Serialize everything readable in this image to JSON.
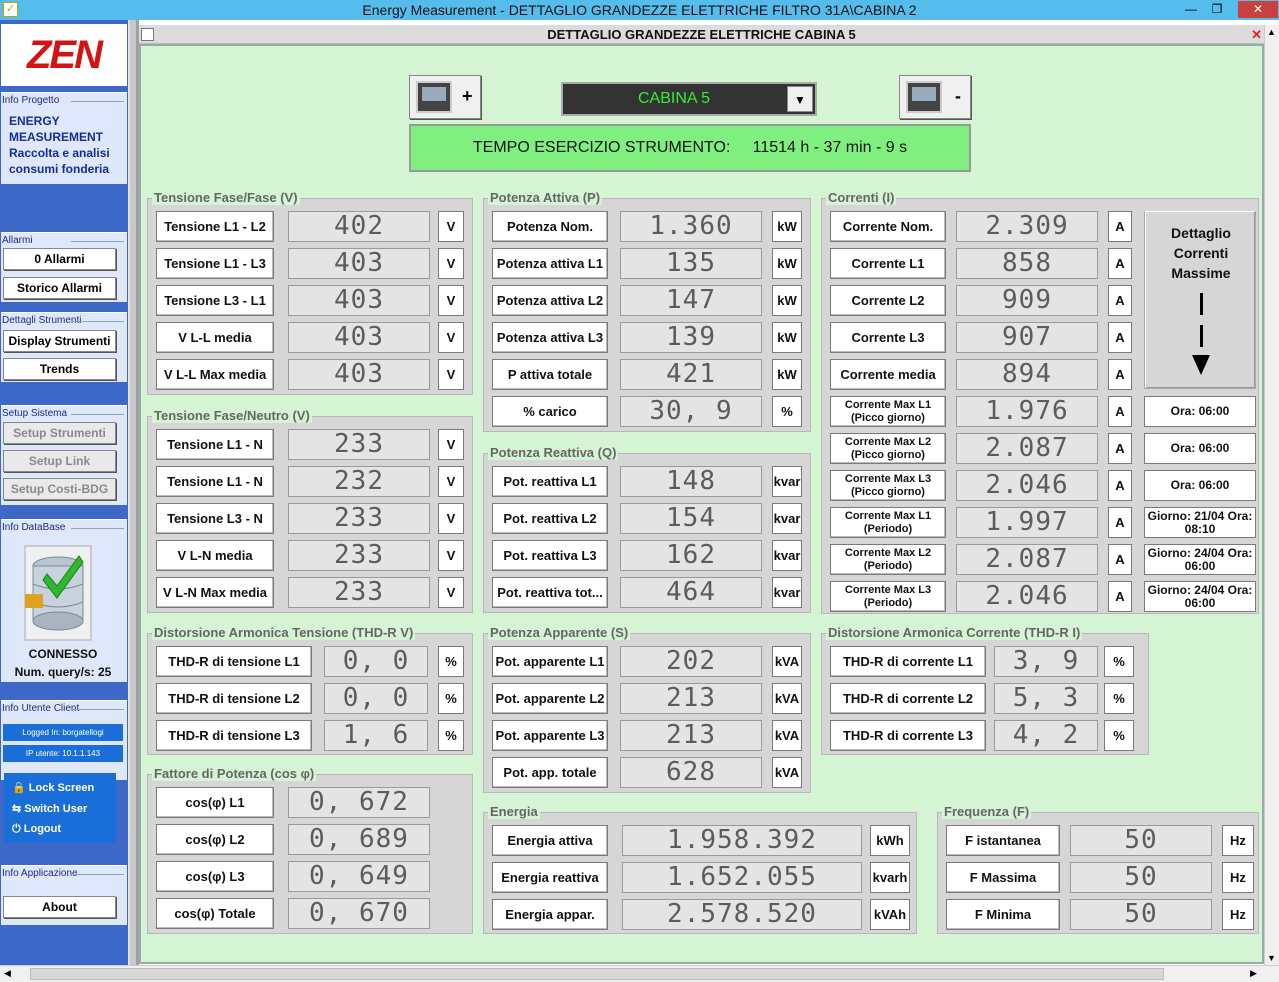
{
  "window": {
    "title": "Energy Measurement - DETTAGLIO GRANDEZZE ELETTRICHE FILTRO 31A\\CABINA 2",
    "app_icon": "check-icon",
    "btn_min": "—",
    "btn_max": "❐",
    "btn_close": "✕"
  },
  "sidebar": {
    "logo": "ZEN",
    "info_progetto": {
      "title": "Info Progetto",
      "text": [
        "ENERGY",
        "MEASUREMENT",
        "Raccolta e analisi",
        "consumi fonderia"
      ]
    },
    "allarmi": {
      "title": "Allarmi",
      "btn1": "0 Allarmi",
      "btn2": "Storico Allarmi"
    },
    "dettagli": {
      "title": "Dettagli Strumenti",
      "btn1": "Display Strumenti",
      "btn2": "Trends"
    },
    "setup": {
      "title": "Setup Sistema",
      "btn1": "Setup Strumenti",
      "btn2": "Setup Link",
      "btn3": "Setup Costi-BDG"
    },
    "database": {
      "title": "Info DataBase",
      "status": "CONNESSO",
      "query_label": "Num. query/s:",
      "query_value": "25"
    },
    "utente": {
      "title": "Info Utente Client",
      "logged": "Logged In: borgatellogi",
      "ip": "IP utente: 10.1.1.143",
      "lock": "Lock Screen",
      "switch": "Switch User",
      "logout": "Logout"
    },
    "applicazione": {
      "title": "Info Applicazione",
      "about": "About"
    }
  },
  "panel": {
    "title": "DETTAGLIO GRANDEZZE ELETTRICHE CABINA 5",
    "close": "✕"
  },
  "header": {
    "cabina": "CABINA 5",
    "plus": "+",
    "minus": "-",
    "tempo_label": "TEMPO ESERCIZIO STRUMENTO:",
    "tempo_value": "11514 h - 37 min - 9 s"
  },
  "groups": {
    "tff": {
      "title": "Tensione Fase/Fase (V)",
      "rows": [
        {
          "l": "Tensione L1 - L2",
          "v": "402",
          "u": "V"
        },
        {
          "l": "Tensione L1 - L3",
          "v": "403",
          "u": "V"
        },
        {
          "l": "Tensione L3 - L1",
          "v": "403",
          "u": "V"
        },
        {
          "l": "V L-L media",
          "v": "403",
          "u": "V"
        },
        {
          "l": "V L-L Max media",
          "v": "403",
          "u": "V"
        }
      ]
    },
    "tfn": {
      "title": "Tensione Fase/Neutro (V)",
      "rows": [
        {
          "l": "Tensione L1 - N",
          "v": "233",
          "u": "V"
        },
        {
          "l": "Tensione L1 - N",
          "v": "232",
          "u": "V"
        },
        {
          "l": "Tensione L3 - N",
          "v": "233",
          "u": "V"
        },
        {
          "l": "V L-N media",
          "v": "233",
          "u": "V"
        },
        {
          "l": "V L-N Max media",
          "v": "233",
          "u": "V"
        }
      ]
    },
    "pa": {
      "title": "Potenza Attiva (P)",
      "rows": [
        {
          "l": "Potenza Nom.",
          "v": "1.360",
          "u": "kW"
        },
        {
          "l": "Potenza attiva L1",
          "v": "135",
          "u": "kW"
        },
        {
          "l": "Potenza attiva L2",
          "v": "147",
          "u": "kW"
        },
        {
          "l": "Potenza attiva L3",
          "v": "139",
          "u": "kW"
        },
        {
          "l": "P attiva totale",
          "v": "421",
          "u": "kW"
        },
        {
          "l": "% carico",
          "v": "30, 9",
          "u": "%"
        }
      ]
    },
    "pr": {
      "title": "Potenza Reattiva (Q)",
      "rows": [
        {
          "l": "Pot. reattiva L1",
          "v": "148",
          "u": "kvar"
        },
        {
          "l": "Pot. reattiva L2",
          "v": "154",
          "u": "kvar"
        },
        {
          "l": "Pot. reattiva L3",
          "v": "162",
          "u": "kvar"
        },
        {
          "l": "Pot. reattiva tot...",
          "v": "464",
          "u": "kvar"
        }
      ]
    },
    "corr": {
      "title": "Correnti (I)",
      "rows": [
        {
          "l": "Corrente Nom.",
          "v": "2.309",
          "u": "A"
        },
        {
          "l": "Corrente L1",
          "v": "858",
          "u": "A"
        },
        {
          "l": "Corrente L2",
          "v": "909",
          "u": "A"
        },
        {
          "l": "Corrente L3",
          "v": "907",
          "u": "A"
        },
        {
          "l": "Corrente media",
          "v": "894",
          "u": "A"
        },
        {
          "l": "Corrente Max L1 (Picco giorno)",
          "v": "1.976",
          "u": "A",
          "i": "Ora: 06:00"
        },
        {
          "l": "Corrente Max L2 (Picco giorno)",
          "v": "2.087",
          "u": "A",
          "i": "Ora: 06:00"
        },
        {
          "l": "Corrente Max L3 (Picco giorno)",
          "v": "2.046",
          "u": "A",
          "i": "Ora: 06:00"
        },
        {
          "l": "Corrente Max L1 (Periodo)",
          "v": "1.997",
          "u": "A",
          "i": "Giorno: 21/04 Ora: 08:10"
        },
        {
          "l": "Corrente Max L2 (Periodo)",
          "v": "2.087",
          "u": "A",
          "i": "Giorno: 24/04 Ora: 06:00"
        },
        {
          "l": "Corrente Max L3 (Periodo)",
          "v": "2.046",
          "u": "A",
          "i": "Giorno: 24/04 Ora: 06:00"
        }
      ],
      "detail": "Dettaglio Correnti Massime"
    },
    "thdv": {
      "title": "Distorsione Armonica Tensione (THD-R V)",
      "rows": [
        {
          "l": "THD-R di tensione L1",
          "v": "0, 0",
          "u": "%"
        },
        {
          "l": "THD-R di tensione L2",
          "v": "0, 0",
          "u": "%"
        },
        {
          "l": "THD-R di tensione L3",
          "v": "1, 6",
          "u": "%"
        }
      ]
    },
    "ps": {
      "title": "Potenza Apparente (S)",
      "rows": [
        {
          "l": "Pot. apparente L1",
          "v": "202",
          "u": "kVA"
        },
        {
          "l": "Pot. apparente L2",
          "v": "213",
          "u": "kVA"
        },
        {
          "l": "Pot. apparente L3",
          "v": "213",
          "u": "kVA"
        },
        {
          "l": "Pot. app. totale",
          "v": "628",
          "u": "kVA"
        }
      ]
    },
    "thdi": {
      "title": "Distorsione Armonica Corrente (THD-R I)",
      "rows": [
        {
          "l": "THD-R di corrente L1",
          "v": "3, 9",
          "u": "%"
        },
        {
          "l": "THD-R di corrente L2",
          "v": "5, 3",
          "u": "%"
        },
        {
          "l": "THD-R di corrente L3",
          "v": "4, 2",
          "u": "%"
        }
      ]
    },
    "cos": {
      "title": "Fattore di Potenza (cos φ)",
      "rows": [
        {
          "l": "cos(φ)   L1",
          "v": "0, 672"
        },
        {
          "l": "cos(φ)   L2",
          "v": "0, 689"
        },
        {
          "l": "cos(φ)   L3",
          "v": "0, 649"
        },
        {
          "l": "cos(φ)   Totale",
          "v": "0, 670"
        }
      ]
    },
    "en": {
      "title": "Energia",
      "rows": [
        {
          "l": "Energia attiva",
          "v": "1.958.392",
          "u": "kWh"
        },
        {
          "l": "Energia reattiva",
          "v": "1.652.055",
          "u": "kvarh"
        },
        {
          "l": "Energia appar.",
          "v": "2.578.520",
          "u": "kVAh"
        }
      ]
    },
    "fr": {
      "title": "Frequenza (F)",
      "rows": [
        {
          "l": "F istantanea",
          "v": "50",
          "u": "Hz"
        },
        {
          "l": "F Massima",
          "v": "50",
          "u": "Hz"
        },
        {
          "l": "F Minima",
          "v": "50",
          "u": "Hz"
        }
      ]
    }
  }
}
